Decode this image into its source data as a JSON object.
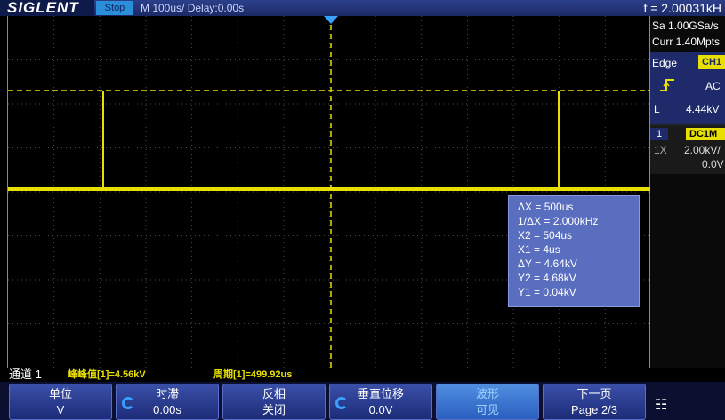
{
  "topbar": {
    "logo": "SIGLENT",
    "run_status": "Stop",
    "timebase": "M 100us/   Delay:0.00s",
    "frequency": "f = 2.00031kH"
  },
  "right_panel": {
    "sample_rate": "Sa 1.00GSa/s",
    "curr_points": "Curr 1.40Mpts",
    "trigger": {
      "type": "Edge",
      "source": "CH1",
      "coupling": "AC",
      "mode": "L",
      "level": "4.44kV"
    },
    "channel": {
      "number": "1",
      "tag": "DC1M",
      "impedance": "1X",
      "scale": "2.00kV/",
      "offset": "0.0V"
    }
  },
  "cursor_box": {
    "lines": [
      "ΔX = 500us",
      "1/ΔX = 2.000kHz",
      "X2 = 504us",
      "X1 = 4us",
      "ΔY = 4.64kV",
      "Y2 = 4.68kV",
      "Y1 = 0.04kV"
    ]
  },
  "measurements": {
    "channel_label": "通道 1",
    "pkpk": "峰峰值[1]=4.56kV",
    "period": "周期[1]=499.92us"
  },
  "softkeys": [
    {
      "top": "单位",
      "bottom": "V"
    },
    {
      "top": "时滞",
      "bottom": "0.00s"
    },
    {
      "top": "反相",
      "bottom": "关闭"
    },
    {
      "top": "垂直位移",
      "bottom": "0.0V"
    },
    {
      "top": "波形",
      "bottom": "可见"
    },
    {
      "top": "下一页",
      "bottom": "Page 2/3"
    }
  ],
  "colors": {
    "trace": "#e8e000",
    "grid": "#4a4a4a",
    "panel_blue": "#1e2a6a"
  },
  "icons": {
    "edge": "rising-edge-icon",
    "knob": "knob-icon",
    "network": "network-icon"
  }
}
